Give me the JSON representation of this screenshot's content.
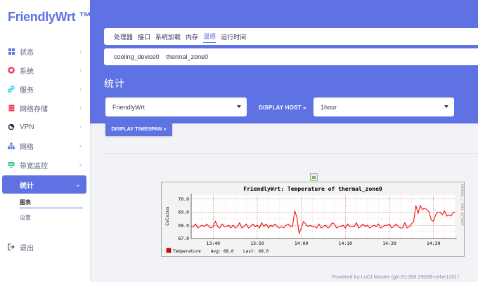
{
  "brand": "FriendlyWrt ™",
  "sidebar": {
    "items": [
      {
        "label": "状态",
        "icon": "dashboard-icon",
        "color": "#5e72e4"
      },
      {
        "label": "系统",
        "icon": "gear-icon",
        "color": "#f5365c"
      },
      {
        "label": "服务",
        "icon": "link-icon",
        "color": "#11cdef"
      },
      {
        "label": "网络存储",
        "icon": "database-icon",
        "color": "#f5365c"
      },
      {
        "label": "VPN",
        "icon": "globe-icon",
        "color": "#172b4d"
      },
      {
        "label": "网络",
        "icon": "network-icon",
        "color": "#5e72e4"
      },
      {
        "label": "带宽监控",
        "icon": "monitor-icon",
        "color": "#2dce89"
      },
      {
        "label": "统计",
        "icon": "",
        "color": "#ffffff"
      }
    ],
    "subitems": [
      "图表",
      "设置"
    ],
    "logout": "退出"
  },
  "tabs": [
    "处理器",
    "接口",
    "系统加载",
    "内存",
    "温感",
    "运行时间"
  ],
  "active_tab": "温感",
  "subtabs": [
    "cooling_device0",
    "thermal_zone0"
  ],
  "page_title": "统计",
  "host_select": "FriendlyWrt",
  "display_host_label": "DISPLAY HOST »",
  "timespan_select": "1hour",
  "display_timespan_label": "DISPLAY TIMESPAN »",
  "graph": {
    "title": "FriendlyWrt: Temperature of thermal_zone0",
    "ylabel": "Celsius",
    "side_label": "RRDTOOL / TOBI OETIKER",
    "legend_name": "Temperature",
    "avg_label": "Avg: 68.0",
    "last_label": "Last: 69.0",
    "series_color": "#ee0000"
  },
  "chart_data": {
    "type": "line",
    "title": "FriendlyWrt: Temperature of thermal_zone0",
    "ylabel": "Celsius",
    "xlabel": "",
    "x_ticks": [
      "13:40",
      "13:50",
      "14:00",
      "14:10",
      "14:20",
      "14:30"
    ],
    "y_ticks": [
      67.0,
      68.0,
      69.0,
      70.0
    ],
    "ylim": [
      67.0,
      70.3
    ],
    "grid": true,
    "series": [
      {
        "name": "Temperature",
        "x_minutes_from_1335": [
          0,
          0.5,
          1,
          1.5,
          2,
          2.5,
          3,
          3.5,
          4,
          4.5,
          5,
          5.5,
          6,
          6.5,
          7,
          7.5,
          8,
          8.5,
          9,
          9.5,
          10,
          10.5,
          11,
          11.5,
          12,
          12.5,
          13,
          13.5,
          14,
          14.5,
          15,
          15.5,
          16,
          16.5,
          17,
          17.5,
          18,
          18.5,
          19,
          19.5,
          20,
          20.5,
          21,
          21.5,
          22,
          22.5,
          23,
          23.5,
          24,
          24.5,
          25,
          25.5,
          26,
          26.5,
          27,
          27.5,
          28,
          28.5,
          29,
          29.5,
          30,
          30.5,
          31,
          31.5,
          32,
          32.5,
          33,
          33.5,
          34,
          34.5,
          35,
          35.5,
          36,
          36.5,
          37,
          37.5,
          38,
          38.5,
          39,
          39.5,
          40,
          40.5,
          41,
          41.5,
          42,
          42.5,
          43,
          43.5,
          44,
          44.5,
          45,
          45.5,
          46,
          46.5,
          47,
          47.5,
          48,
          48.5,
          49,
          49.5,
          50,
          50.5,
          51,
          51.5,
          52,
          52.5,
          53,
          53.5,
          54,
          54.5,
          55,
          55.5,
          56,
          56.5,
          57,
          57.5,
          58,
          58.5,
          59,
          59.5,
          60
        ],
        "values": [
          67.9,
          67.9,
          68.1,
          67.8,
          67.9,
          68.0,
          67.9,
          68.1,
          67.9,
          67.8,
          67.9,
          68.3,
          67.9,
          67.8,
          68.1,
          67.9,
          67.9,
          68.0,
          67.8,
          68.0,
          67.8,
          67.9,
          68.2,
          67.8,
          67.9,
          68.1,
          67.8,
          67.9,
          68.1,
          67.9,
          68.0,
          67.8,
          68.2,
          67.9,
          68.1,
          67.8,
          68.0,
          67.9,
          68.1,
          67.9,
          67.8,
          67.9,
          67.8,
          68.0,
          68.1,
          67.9,
          67.9,
          69.1,
          68.6,
          67.4,
          67.8,
          68.3,
          68.1,
          67.9,
          68.0,
          67.9,
          67.9,
          67.8,
          68.1,
          67.8,
          67.9,
          68.0,
          67.8,
          67.9,
          68.2,
          68.1,
          67.8,
          67.9,
          67.9,
          68.0,
          67.8,
          68.1,
          67.9,
          67.9,
          67.9,
          68.2,
          67.8,
          67.9,
          68.1,
          67.9,
          68.0,
          67.8,
          67.9,
          68.0,
          67.9,
          68.1,
          67.8,
          67.9,
          68.0,
          68.0,
          68.1,
          67.8,
          67.9,
          68.1,
          67.9,
          67.8,
          67.8,
          68.2,
          67.8,
          67.9,
          68.1,
          68.3,
          69.5,
          68.9,
          69.5,
          69.2,
          69.3,
          69.2,
          69.0,
          68.4,
          68.3,
          68.8,
          69.0,
          69.0,
          68.8,
          69.1,
          68.7,
          68.8,
          68.7,
          69.0,
          69.0
        ]
      }
    ]
  },
  "footer": "Powered by LuCI Master (git-20.088.29068-cebe120) /"
}
